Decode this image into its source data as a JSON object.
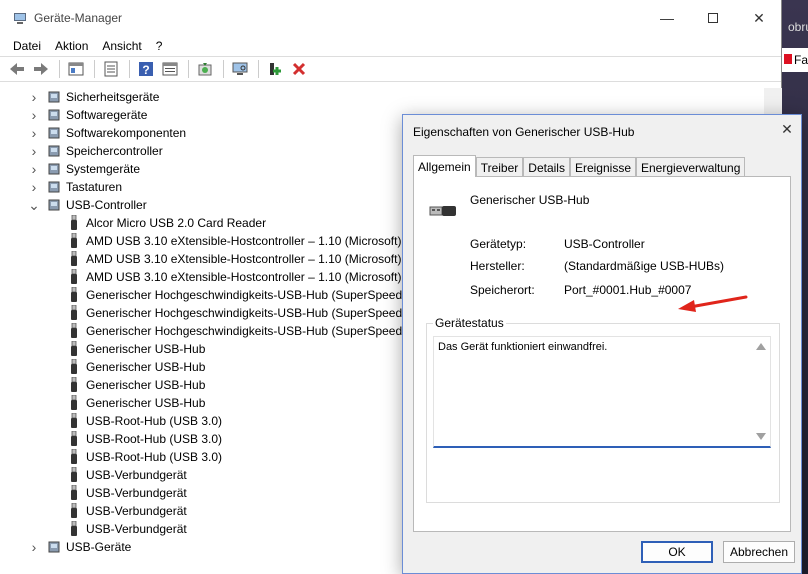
{
  "window": {
    "title": "Geräte-Manager",
    "menu": [
      "Datei",
      "Aktion",
      "Ansicht",
      "?"
    ]
  },
  "background": {
    "text": "obrue",
    "tab_text": "Fa"
  },
  "toolbar": [
    "back-icon",
    "forward-icon",
    "properties-view-icon",
    "show-hidden-icon",
    "help-icon",
    "details-icon",
    "update-driver-icon",
    "scan-hardware-icon",
    "add-driver-icon",
    "uninstall-icon"
  ],
  "tree": {
    "rows": [
      {
        "label": "Sicherheitsgeräte",
        "level": 0,
        "expanded": false
      },
      {
        "label": "Softwaregeräte",
        "level": 0,
        "expanded": false
      },
      {
        "label": "Softwarekomponenten",
        "level": 0,
        "expanded": false
      },
      {
        "label": "Speichercontroller",
        "level": 0,
        "expanded": false
      },
      {
        "label": "Systemgeräte",
        "level": 0,
        "expanded": false
      },
      {
        "label": "Tastaturen",
        "level": 0,
        "expanded": false
      },
      {
        "label": "USB-Controller",
        "level": 0,
        "expanded": true
      },
      {
        "label": "Alcor Micro USB 2.0 Card Reader",
        "level": 1
      },
      {
        "label": "AMD USB 3.10 eXtensible-Hostcontroller – 1.10 (Microsoft)",
        "level": 1
      },
      {
        "label": "AMD USB 3.10 eXtensible-Hostcontroller – 1.10 (Microsoft)",
        "level": 1
      },
      {
        "label": "AMD USB 3.10 eXtensible-Hostcontroller – 1.10 (Microsoft)",
        "level": 1
      },
      {
        "label": "Generischer Hochgeschwindigkeits-USB-Hub (SuperSpeed)",
        "level": 1
      },
      {
        "label": "Generischer Hochgeschwindigkeits-USB-Hub (SuperSpeed)",
        "level": 1
      },
      {
        "label": "Generischer Hochgeschwindigkeits-USB-Hub (SuperSpeed)",
        "level": 1
      },
      {
        "label": "Generischer USB-Hub",
        "level": 1
      },
      {
        "label": "Generischer USB-Hub",
        "level": 1
      },
      {
        "label": "Generischer USB-Hub",
        "level": 1
      },
      {
        "label": "Generischer USB-Hub",
        "level": 1
      },
      {
        "label": "USB-Root-Hub (USB 3.0)",
        "level": 1
      },
      {
        "label": "USB-Root-Hub (USB 3.0)",
        "level": 1
      },
      {
        "label": "USB-Root-Hub (USB 3.0)",
        "level": 1
      },
      {
        "label": "USB-Verbundgerät",
        "level": 1
      },
      {
        "label": "USB-Verbundgerät",
        "level": 1
      },
      {
        "label": "USB-Verbundgerät",
        "level": 1
      },
      {
        "label": "USB-Verbundgerät",
        "level": 1
      },
      {
        "label": "USB-Geräte",
        "level": 0,
        "expanded": false
      }
    ]
  },
  "dialog": {
    "title": "Eigenschaften von Generischer USB-Hub",
    "tabs": [
      "Allgemein",
      "Treiber",
      "Details",
      "Ereignisse",
      "Energieverwaltung"
    ],
    "active_tab": "Allgemein",
    "device_name": "Generischer USB-Hub",
    "properties": [
      {
        "label": "Gerätetyp:",
        "value": "USB-Controller"
      },
      {
        "label": "Hersteller:",
        "value": "(Standardmäßige USB-HUBs)"
      },
      {
        "label": "Speicherort:",
        "value": "Port_#0001.Hub_#0007"
      }
    ],
    "status_group": "Gerätestatus",
    "status_text": "Das Gerät funktioniert einwandfrei.",
    "ok": "OK",
    "cancel": "Abbrechen"
  },
  "colors": {
    "accent": "#2e5fb7",
    "arrow": "#e0251b"
  }
}
